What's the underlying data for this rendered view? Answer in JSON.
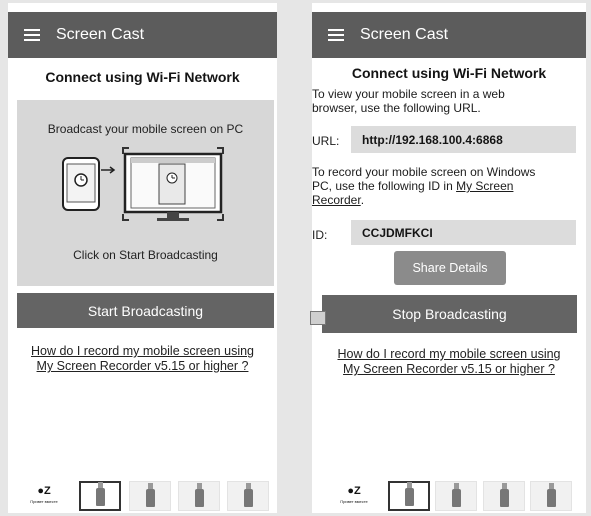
{
  "left": {
    "app_title": "Screen Cast",
    "heading": "Connect using Wi-Fi Network",
    "broadcast_text": "Broadcast your mobile screen on PC",
    "instruction": "Click on Start Broadcasting",
    "start_button": "Start Broadcasting",
    "help_link_line1": "How do I record my mobile screen using",
    "help_link_line2": "My Screen Recorder v5.15 or higher ?"
  },
  "right": {
    "app_title": "Screen Cast",
    "heading": "Connect using Wi-Fi Network",
    "view_text_line1": "To view your mobile screen in a web",
    "view_text_line2": "browser, use the following URL.",
    "url_label": "URL:",
    "url_value": "http://192.168.100.4:6868",
    "record_text_line1": "To record your mobile screen on Windows",
    "record_text_line2": "PC, use the following ID in ",
    "record_link_part1": "My Screen",
    "record_link_part2": "Recorder",
    "record_text_end": ".",
    "id_label": "ID:",
    "id_value": "CCJDMFKCI",
    "share_button": "Share Details",
    "stop_button": "Stop Broadcasting",
    "help_link_line1": "How do I record my mobile screen using",
    "help_link_line2": "My Screen Recorder v5.15 or higher ?"
  },
  "ads": {
    "logo": "●Z",
    "logo_sub": "Привет вместе"
  }
}
